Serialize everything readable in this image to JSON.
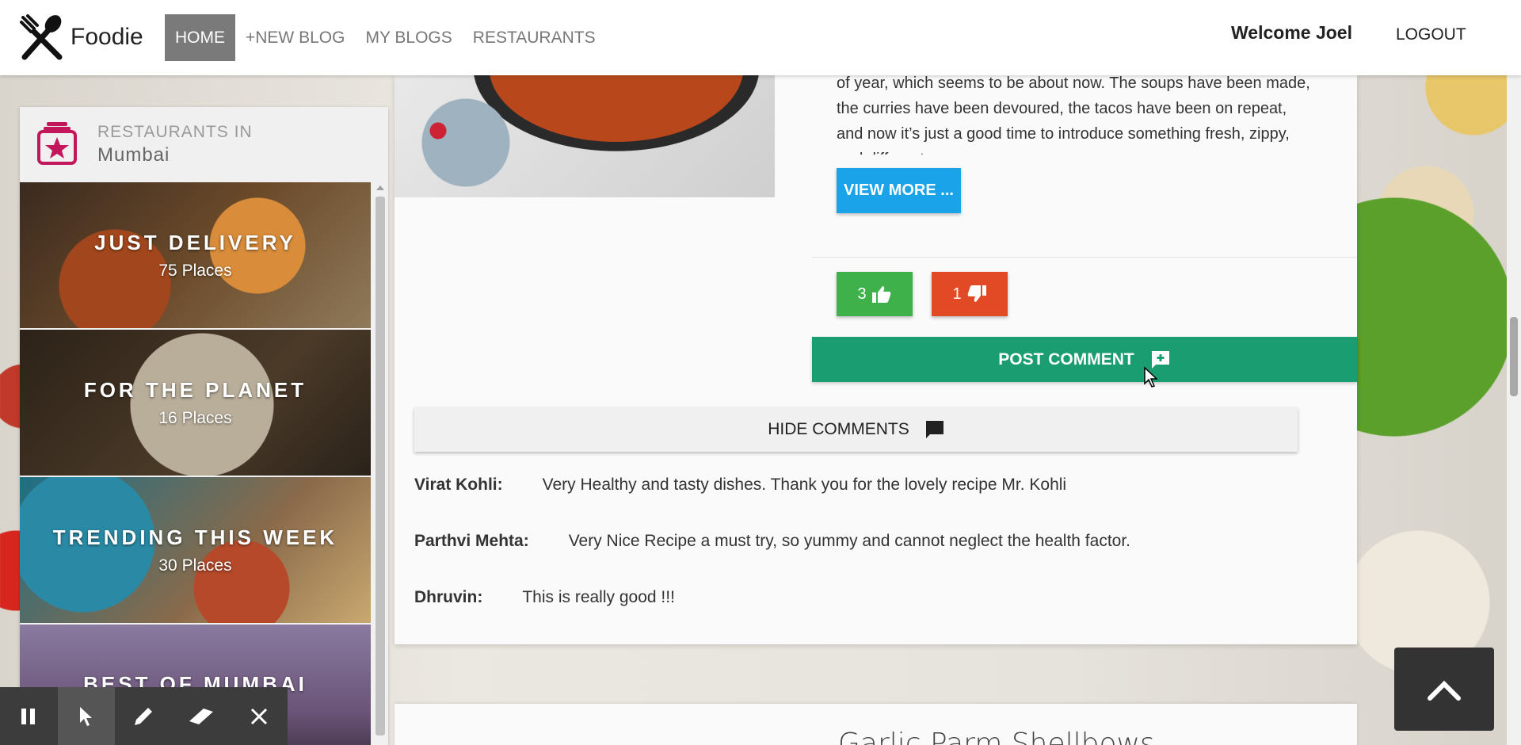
{
  "navbar": {
    "brand": "Foodie",
    "links": [
      "HOME",
      "+NEW BLOG",
      "MY BLOGS",
      "RESTAURANTS"
    ],
    "welcome": "Welcome Joel",
    "logout": "LOGOUT"
  },
  "sidebar": {
    "title": "RESTAURANTS IN",
    "city": "Mumbai",
    "tiles": [
      {
        "name": "JUST DELIVERY",
        "count": "75 Places"
      },
      {
        "name": "FOR THE PLANET",
        "count": "16 Places"
      },
      {
        "name": "TRENDING THIS WEEK",
        "count": "30 Places"
      },
      {
        "name": "BEST OF MUMBAI",
        "count": ""
      }
    ]
  },
  "post": {
    "text": "of year, which seems to be about now. The soups have been made, the curries have been devoured, the tacos have been on repeat, and now it’s just a good time to introduce something fresh, zippy, and different.",
    "view_more": "VIEW MORE ...",
    "likes": "3",
    "dislikes": "1",
    "post_comment": "POST COMMENT",
    "hide_comments": "HIDE COMMENTS",
    "comments": [
      {
        "author": "Virat Kohli:",
        "text": "Very Healthy and tasty dishes. Thank you for the lovely recipe Mr. Kohli"
      },
      {
        "author": "Parthvi Mehta:",
        "text": "Very Nice Recipe a must try, so yummy and cannot neglect the health factor."
      },
      {
        "author": "Dhruvin:",
        "text": "This is really good !!!"
      }
    ]
  },
  "next_post": {
    "title": "Garlic Parm Shellbows"
  },
  "colors": {
    "view_more": "#1aa3e8",
    "like": "#3fb14a",
    "dislike": "#e24a26",
    "post_comment": "#1a9e71",
    "brand_icon": "#c2185b"
  }
}
